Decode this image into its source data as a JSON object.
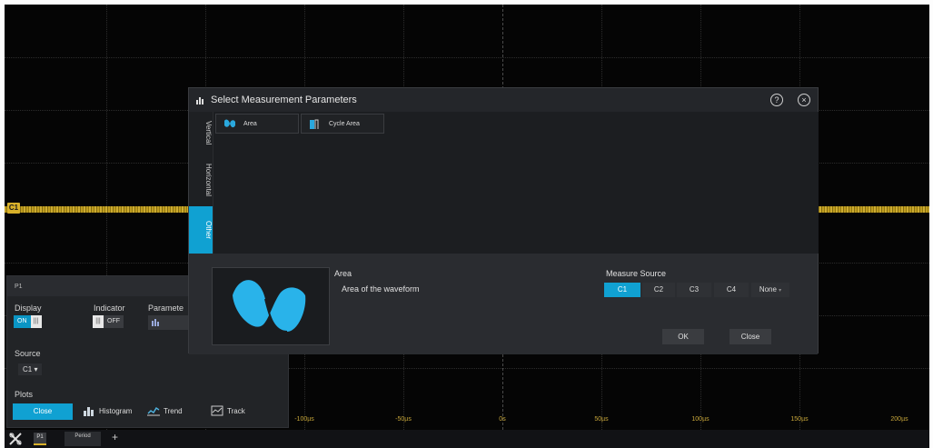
{
  "scope": {
    "channel_marker": "C1",
    "time_labels": [
      "-100µs",
      "-50µs",
      "0s",
      "50µs",
      "100µs",
      "150µs",
      "200µs"
    ]
  },
  "p1_panel": {
    "title": "P1",
    "display_label": "Display",
    "display_on": "ON",
    "indicator_label": "Indicator",
    "indicator_off": "OFF",
    "parameter_label": "Paramete",
    "source_label": "Source",
    "source_value": "C1",
    "plots_label": "Plots",
    "close_label": "Close",
    "histogram_label": "Histogram",
    "trend_label": "Trend",
    "track_label": "Track"
  },
  "bottom_bar": {
    "badge_label": "P1",
    "period_label": "Period"
  },
  "dialog": {
    "title": "Select Measurement Parameters",
    "tabs": [
      "Vertical",
      "Horizontal",
      "Other"
    ],
    "active_tab": "Other",
    "params": [
      {
        "name": "Area",
        "icon": "area-icon"
      },
      {
        "name": "Cycle Area",
        "icon": "cycle-area-icon"
      }
    ],
    "selected_name": "Area",
    "selected_desc": "Area of the waveform",
    "source_label": "Measure Source",
    "sources": [
      "C1",
      "C2",
      "C3",
      "C4",
      "None"
    ],
    "active_source": "C1",
    "ok_label": "OK",
    "close_label": "Close"
  },
  "colors": {
    "accent": "#10a1d2",
    "trace": "#d9b12a",
    "background": "#050505",
    "panel": "#2a2c30"
  }
}
